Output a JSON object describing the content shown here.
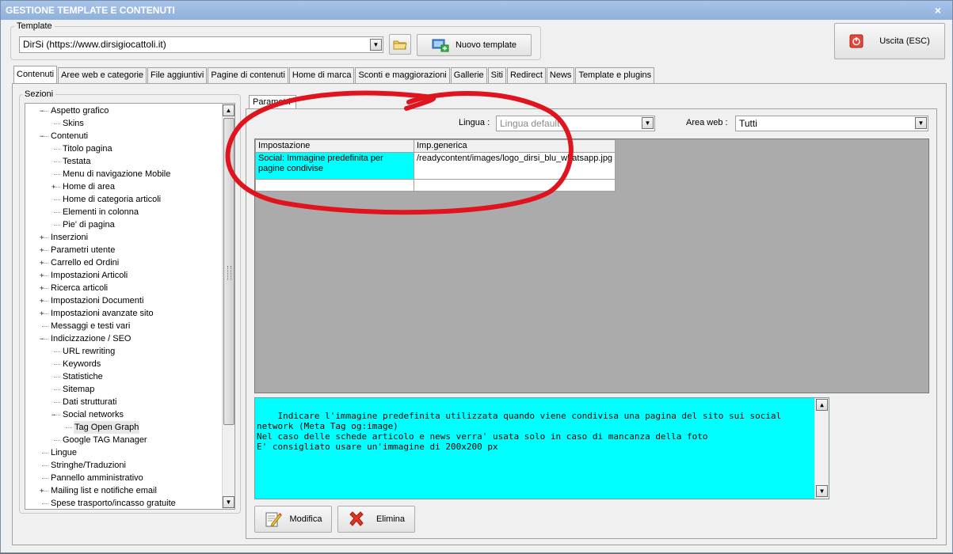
{
  "window": {
    "title": "GESTIONE TEMPLATE E CONTENUTI",
    "close_glyph": "×"
  },
  "template_group": {
    "legend": "Template",
    "selected": "DirSi (https://www.dirsigiocattoli.it)",
    "new_template_label": "Nuovo template"
  },
  "exit_button": {
    "label": "Uscita (ESC)"
  },
  "tabs": [
    "Contenuti",
    "Aree web e categorie",
    "File aggiuntivi",
    "Pagine di contenuti",
    "Home di marca",
    "Sconti e maggiorazioni",
    "Gallerie",
    "Siti",
    "Redirect",
    "News",
    "Template e plugins"
  ],
  "sections": {
    "legend": "Sezioni",
    "tree": [
      {
        "label": "Aspetto grafico",
        "level": 1,
        "expander": "−"
      },
      {
        "label": "Skins",
        "level": 2,
        "expander": ""
      },
      {
        "label": "Contenuti",
        "level": 1,
        "expander": "−"
      },
      {
        "label": "Titolo pagina",
        "level": 2,
        "expander": ""
      },
      {
        "label": "Testata",
        "level": 2,
        "expander": ""
      },
      {
        "label": "Menu di navigazione Mobile",
        "level": 2,
        "expander": ""
      },
      {
        "label": "Home di area",
        "level": 2,
        "expander": "+"
      },
      {
        "label": "Home di categoria articoli",
        "level": 2,
        "expander": ""
      },
      {
        "label": "Elementi in colonna",
        "level": 2,
        "expander": ""
      },
      {
        "label": "Pie' di pagina",
        "level": 2,
        "expander": ""
      },
      {
        "label": "Inserzioni",
        "level": 1,
        "expander": "+"
      },
      {
        "label": "Parametri utente",
        "level": 1,
        "expander": "+"
      },
      {
        "label": "Carrello ed Ordini",
        "level": 1,
        "expander": "+"
      },
      {
        "label": "Impostazioni Articoli",
        "level": 1,
        "expander": "+"
      },
      {
        "label": "Ricerca articoli",
        "level": 1,
        "expander": "+"
      },
      {
        "label": "Impostazioni Documenti",
        "level": 1,
        "expander": "+"
      },
      {
        "label": "Impostazioni avanzate sito",
        "level": 1,
        "expander": "+"
      },
      {
        "label": "Messaggi e testi vari",
        "level": 1,
        "expander": ""
      },
      {
        "label": "Indicizzazione / SEO",
        "level": 1,
        "expander": "−"
      },
      {
        "label": "URL rewriting",
        "level": 2,
        "expander": ""
      },
      {
        "label": "Keywords",
        "level": 2,
        "expander": ""
      },
      {
        "label": "Statistiche",
        "level": 2,
        "expander": ""
      },
      {
        "label": "Sitemap",
        "level": 2,
        "expander": ""
      },
      {
        "label": "Dati strutturati",
        "level": 2,
        "expander": ""
      },
      {
        "label": "Social networks",
        "level": 2,
        "expander": "−"
      },
      {
        "label": "Tag Open Graph",
        "level": 3,
        "expander": "",
        "selected": true
      },
      {
        "label": "Google TAG Manager",
        "level": 2,
        "expander": ""
      },
      {
        "label": "Lingue",
        "level": 1,
        "expander": ""
      },
      {
        "label": "Stringhe/Traduzioni",
        "level": 1,
        "expander": ""
      },
      {
        "label": "Pannello amministrativo",
        "level": 1,
        "expander": ""
      },
      {
        "label": "Mailing list e notifiche email",
        "level": 1,
        "expander": "+"
      },
      {
        "label": "Spese trasporto/incasso gratuite",
        "level": 1,
        "expander": ""
      }
    ]
  },
  "params": {
    "tab_label": "Parametri",
    "lingua_label": "Lingua :",
    "lingua_value": "Lingua default",
    "area_label": "Area web :",
    "area_value": "Tutti",
    "grid": {
      "headers": [
        "Impostazione",
        "Imp.generica"
      ],
      "rows": [
        [
          "Social: Immagine predefinita per pagine condivise",
          "/readycontent/images/logo_dirsi_blu_whatsapp.jpg"
        ],
        [
          "",
          ""
        ]
      ]
    },
    "info_text": "Indicare l'immagine predefinita utilizzata quando viene condivisa una pagina del sito sui social network (Meta Tag og:image)\nNel caso delle schede articolo e news verra' usata solo in caso di mancanza della foto\nE' consigliato usare un'immagine di 200x200 px",
    "modifica_label": "Modifica",
    "elimina_label": "Elimina"
  },
  "colors": {
    "annotation_red": "#e0141e",
    "info_background": "#00ffff",
    "grid_selected": "#00ffff",
    "titlebar": "#8fb0dc"
  }
}
